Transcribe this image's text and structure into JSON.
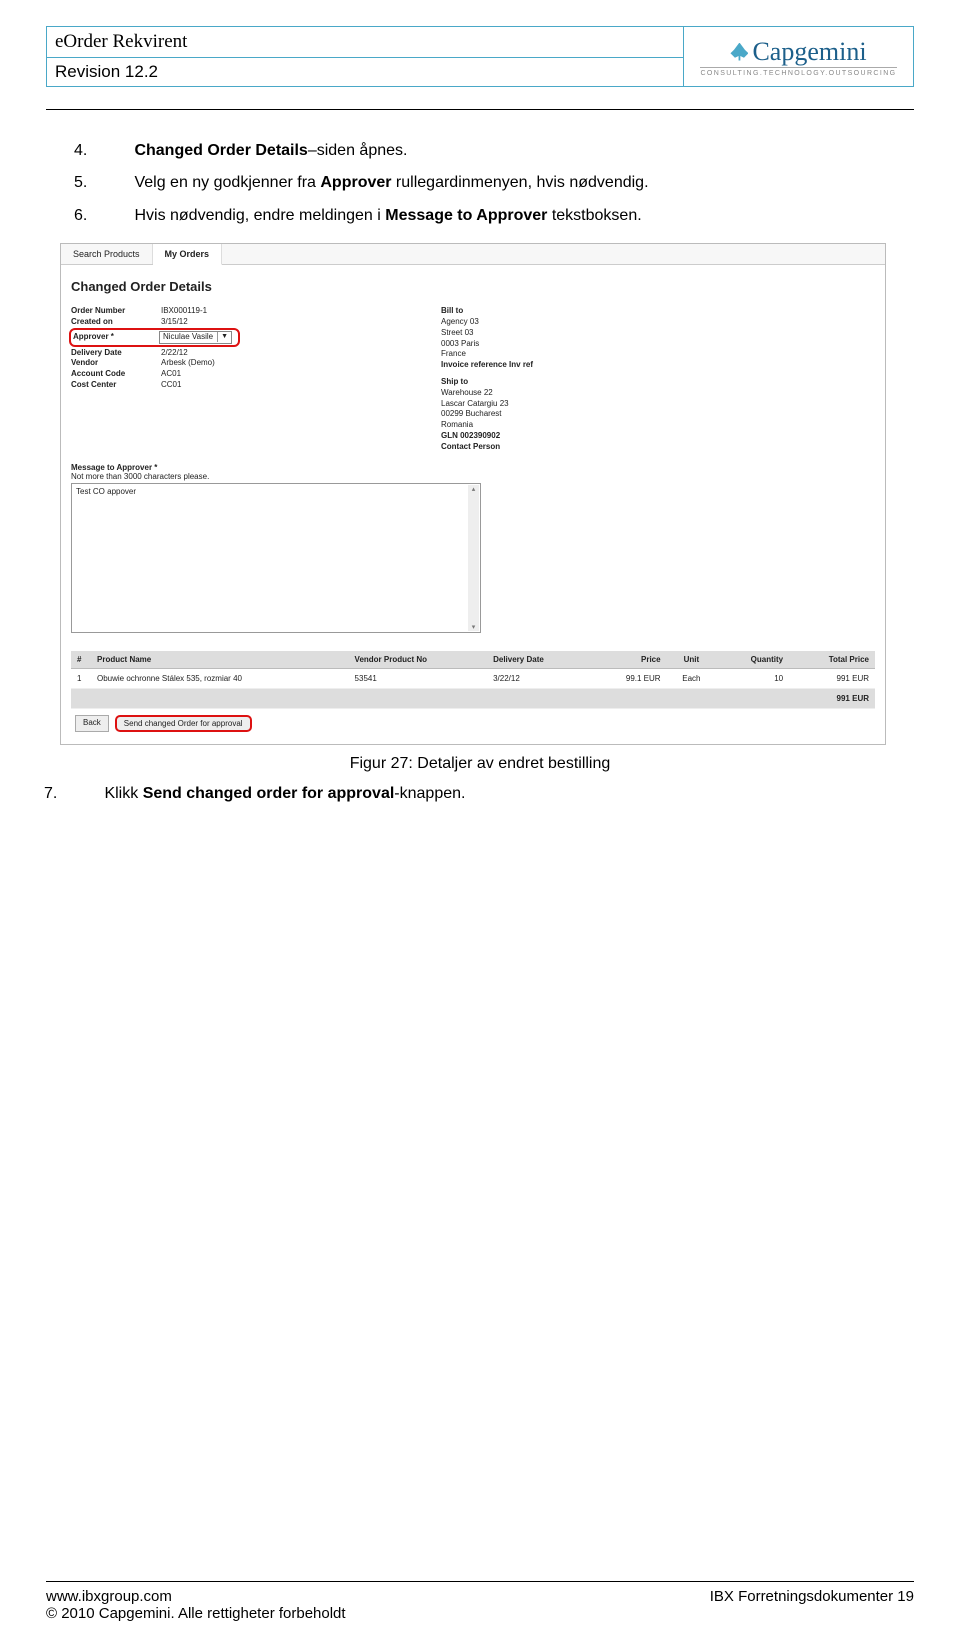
{
  "header": {
    "title": "eOrder Rekvirent",
    "revision": "Revision 12.2",
    "logo_text": "Capgemini",
    "logo_tag": "CONSULTING.TECHNOLOGY.OUTSOURCING"
  },
  "steps": {
    "s4_num": "4.",
    "s4_a": "Changed Order Details",
    "s4_b": "–siden åpnes.",
    "s5_num": "5.",
    "s5_a": "Velg en ny godkjenner fra ",
    "s5_b": "Approver",
    "s5_c": " rullegardinmenyen, hvis nødvendig.",
    "s6_num": "6.",
    "s6_a": "Hvis nødvendig, endre meldingen i ",
    "s6_b": "Message to Approver",
    "s6_c": " tekstboksen.",
    "s7_num": "7.",
    "s7_a": "Klikk ",
    "s7_b": "Send changed order for approval",
    "s7_c": "-knappen."
  },
  "shot": {
    "tab1": "Search Products",
    "tab2": "My Orders",
    "heading": "Changed Order Details",
    "left": {
      "order_number_k": "Order Number",
      "order_number_v": "IBX000119-1",
      "created_on_k": "Created on",
      "created_on_v": "3/15/12",
      "approver_k": "Approver *",
      "approver_v": "Niculae Vasile",
      "delivery_date_k": "Delivery Date",
      "delivery_date_v": "2/22/12",
      "vendor_k": "Vendor",
      "vendor_v": "Arbesk (Demo)",
      "account_code_k": "Account Code",
      "account_code_v": "AC01",
      "cost_center_k": "Cost Center",
      "cost_center_v": "CC01"
    },
    "right": {
      "billto_h": "Bill to",
      "billto_1": "Agency 03",
      "billto_2": "Street 03",
      "billto_3": "0003  Paris",
      "billto_4": "France",
      "billto_5": "Invoice reference Inv ref",
      "shipto_h": "Ship to",
      "shipto_1": "Warehouse 22",
      "shipto_2": "Lascar Catargiu 23",
      "shipto_3": "00299  Bucharest",
      "shipto_4": "Romania",
      "shipto_5": "GLN 002390902",
      "shipto_6": "Contact Person"
    },
    "msg_label": "Message to Approver *",
    "msg_hint": "Not more than 3000 characters please.",
    "msg_value": "Test CO appover",
    "table": {
      "h_num": "#",
      "h_name": "Product Name",
      "h_vpn": "Vendor Product No",
      "h_dd": "Delivery Date",
      "h_price": "Price",
      "h_unit": "Unit",
      "h_qty": "Quantity",
      "h_total": "Total Price",
      "r1_num": "1",
      "r1_name": "Obuwie ochronne Stálex 535, rozmiar 40",
      "r1_vpn": "53541",
      "r1_dd": "3/22/12",
      "r1_price": "99.1 EUR",
      "r1_unit": "Each",
      "r1_qty": "10",
      "r1_total": "991 EUR",
      "grand_total": "991 EUR"
    },
    "btn_back": "Back",
    "btn_send": "Send changed Order for approval"
  },
  "caption": "Figur 27: Detaljer av endret bestilling",
  "footer": {
    "url": "www.ibxgroup.com",
    "right": "IBX Forretningsdokumenter 19",
    "copyright": "© 2010 Capgemini. Alle rettigheter forbeholdt"
  }
}
